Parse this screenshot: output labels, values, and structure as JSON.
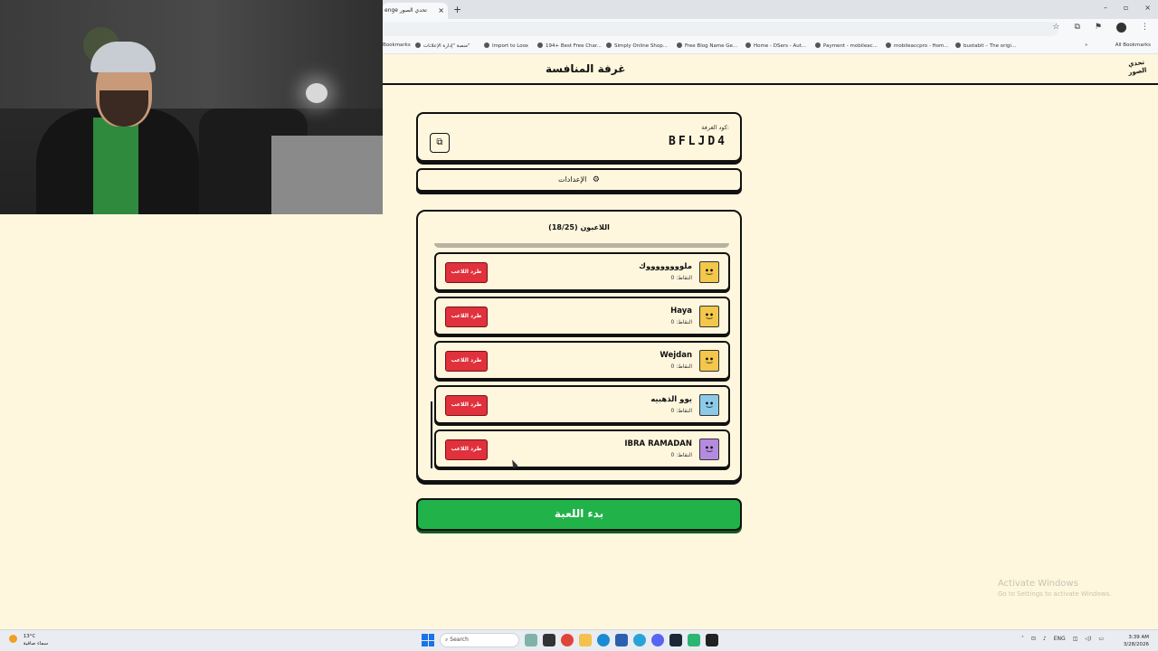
{
  "browser": {
    "tab_title": "enge  تحدي الصور",
    "tab_close": "×",
    "new_tab": "+",
    "window_controls": [
      "–",
      "▫",
      "×"
    ],
    "bookmarks": [
      "Bookmarks",
      "منصة \"إدارة الإعلانات\"",
      "Import to Loox",
      "194+ Best Free Char...",
      "Simply Online Shop...",
      "Free Blog Name Ge...",
      "Home - DSers - Aut...",
      "Payment - mobileac...",
      "mobileaccpro - Hom...",
      "bustabit – The origi..."
    ],
    "more_bookmarks": "»",
    "all_bookmarks": "All Bookmarks"
  },
  "app": {
    "title": "غرفة المنافسة",
    "logo": "تحدي الصور",
    "room_label": "كود الغرفة:",
    "room_code": "BFLJD4",
    "settings_label": "الإعدادات",
    "players_title": "اللاعبون (18/25)",
    "kick_label": "طرد اللاعب",
    "start_label": "بدء اللعبة",
    "players": [
      {
        "name": "ملووووووووك",
        "points": "النقاط: 0",
        "avatar_color": "#f3c74b"
      },
      {
        "name": "Haya",
        "points": "النقاط: 0",
        "avatar_color": "#f3c74b"
      },
      {
        "name": "Wejdan",
        "points": "النقاط: 0",
        "avatar_color": "#f3c74b"
      },
      {
        "name": "يوو الذهبيه",
        "points": "النقاط: 0",
        "avatar_color": "#8ccbe8"
      },
      {
        "name": "IBRA RAMADAN",
        "points": "النقاط: 0",
        "avatar_color": "#b58be0"
      }
    ]
  },
  "watermark": {
    "line1": "Activate Windows",
    "line2": "Go to Settings to activate Windows."
  },
  "taskbar": {
    "temperature": "13°C",
    "weather_desc": "سماء صافية",
    "search_placeholder": "Search",
    "language": "ENG",
    "time": "3:39 AM",
    "date": "3/28/2026"
  }
}
